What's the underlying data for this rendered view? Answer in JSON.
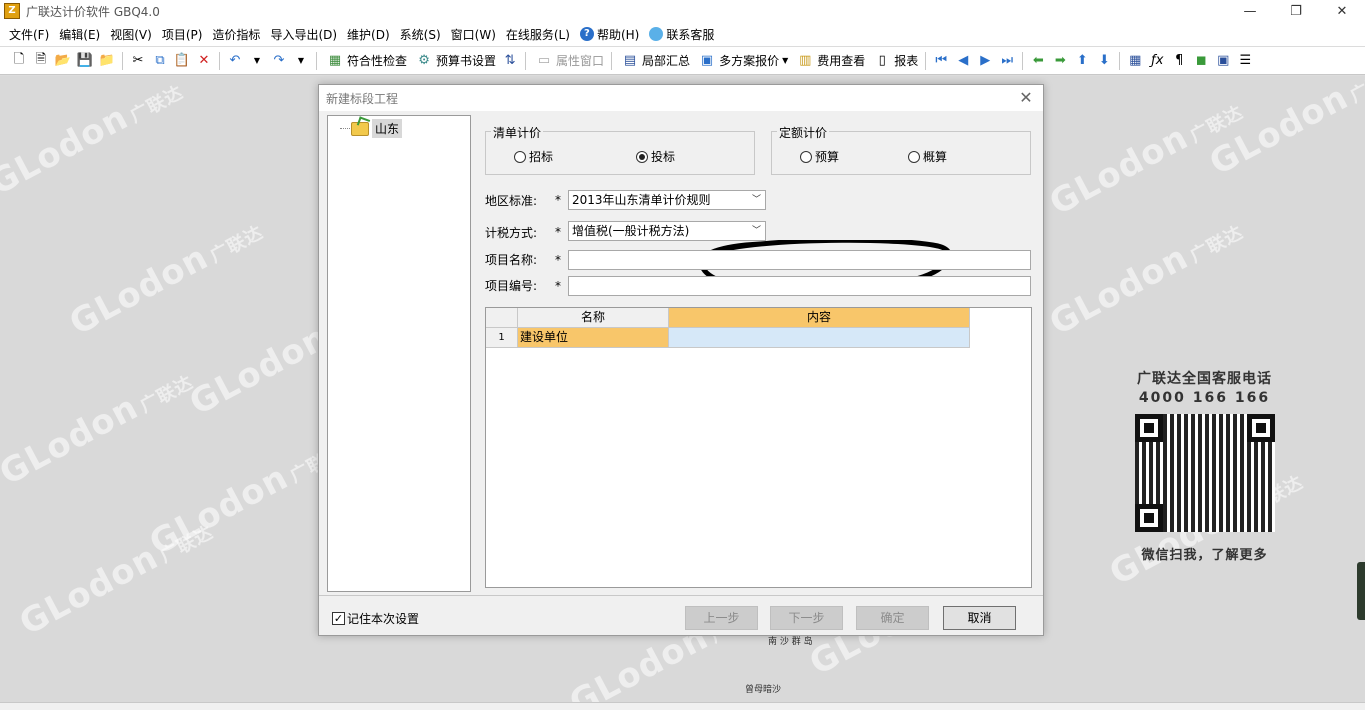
{
  "app": {
    "title": "广联达计价软件 GBQ4.0",
    "icon_letter": "Z"
  },
  "window_controls": {
    "minimize": "—",
    "maximize": "❐",
    "close": "✕"
  },
  "menu": [
    "文件(F)",
    "编辑(E)",
    "视图(V)",
    "项目(P)",
    "造价指标",
    "导入导出(D)",
    "维护(D)",
    "系统(S)",
    "窗口(W)",
    "在线服务(L)"
  ],
  "menu_help": "帮助(H)",
  "menu_contact": "联系客服",
  "toolbar": {
    "compliance_check": "符合性检查",
    "budget_settings": "预算书设置",
    "property_window": "属性窗口",
    "partial_summary": "局部汇总",
    "multi_scheme_quote": "多方案报价",
    "fee_view": "费用查看",
    "report": "报表"
  },
  "watermark": {
    "brand": "GLodon",
    "cn": "广联达"
  },
  "ad": {
    "title": "广联达全国客服电话",
    "phone": "4000 166 166",
    "tagline": "微信扫我，了解更多"
  },
  "background_hints": [
    "南 沙 群 岛",
    "曾母暗沙"
  ],
  "dialog": {
    "title": "新建标段工程",
    "close": "✕",
    "tree": {
      "root": "山东"
    },
    "bill_pricing": {
      "legend": "清单计价",
      "options": [
        "招标",
        "投标"
      ],
      "selected": "投标"
    },
    "quota_pricing": {
      "legend": "定额计价",
      "options": [
        "预算",
        "概算"
      ],
      "selected": ""
    },
    "region_standard": {
      "label": "地区标准:",
      "required": "*",
      "value": "2013年山东清单计价规则"
    },
    "tax_method": {
      "label": "计税方式:",
      "required": "*",
      "value": "增值税(一般计税方法)"
    },
    "project_name": {
      "label": "项目名称:",
      "required": "*",
      "value": ""
    },
    "project_code": {
      "label": "项目编号:",
      "required": "*",
      "value": ""
    },
    "grid": {
      "headers": [
        "",
        "名称",
        "内容"
      ],
      "rows": [
        {
          "num": "1",
          "name": "建设单位",
          "content": ""
        }
      ]
    },
    "remember_setting": {
      "label": "记住本次设置",
      "checked": true
    },
    "buttons": {
      "prev": "上一步",
      "next": "下一步",
      "ok": "确定",
      "cancel": "取消"
    }
  },
  "colors": {
    "grid_highlight": "#f8c66a",
    "grid_cell_blue": "#d6e8f8",
    "workspace": "#d9d9d9"
  }
}
